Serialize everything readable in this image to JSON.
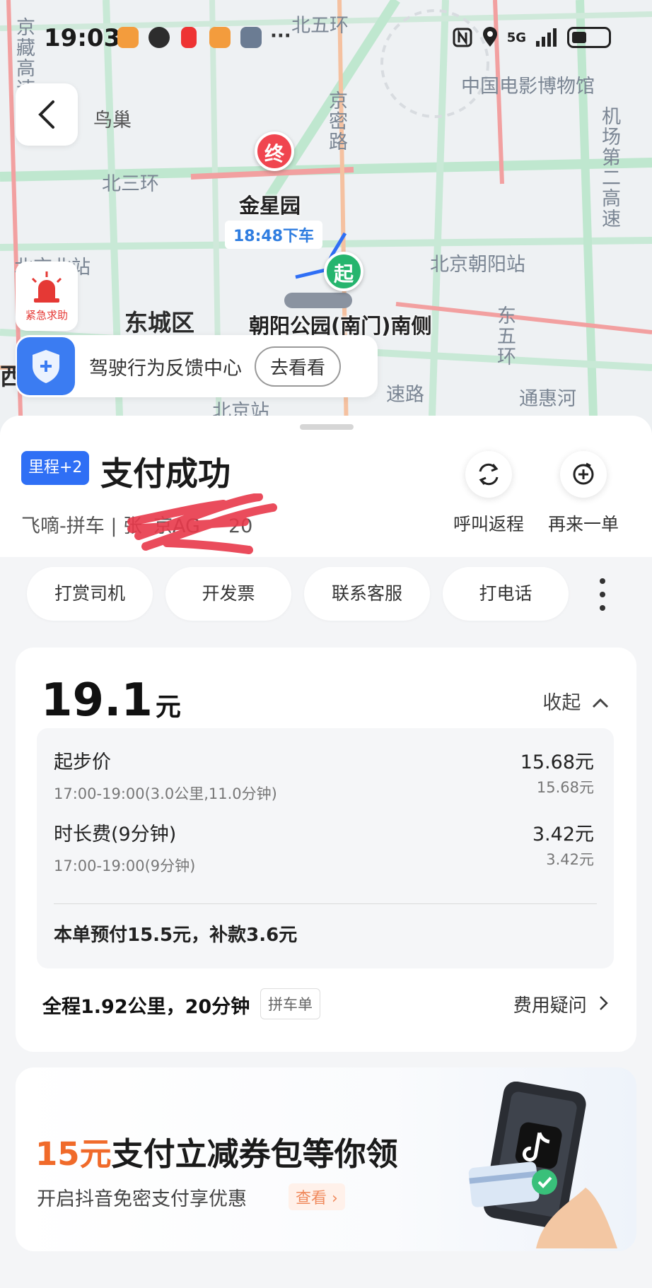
{
  "status": {
    "time": "19:03",
    "network": "5G"
  },
  "map": {
    "labels": {
      "bird_nest": "鸟巢",
      "north_5th_ring": "北五环",
      "film_museum": "中国电影博物馆",
      "jingmi_road": "京密路",
      "north_3rd_ring": "北三环",
      "airport_expressway": "机场第二高速",
      "jingzang_express": "京藏高速",
      "destination": "金星园",
      "eta": "18:48下车",
      "chaoyang_station": "北京朝阳站",
      "beijing_north": "北京北站",
      "dongcheng": "东城区",
      "origin": "朝阳公园(南门)南侧",
      "east_5th_ring": "东五环",
      "tonghui_river": "通惠河",
      "express_road": "速路",
      "beijing_station": "北京站",
      "west": "西"
    },
    "end_pin": "终",
    "start_pin": "起"
  },
  "sos": {
    "label": "紧急求助"
  },
  "feedback": {
    "text": "驾驶行为反馈中心",
    "button": "去看看"
  },
  "order": {
    "badge": "里程+2",
    "title": "支付成功",
    "service_info": "飞嘀-拼车 | 张",
    "plate_partial": "京AG",
    "plate_tail": "20",
    "actions": [
      {
        "label": "呼叫返程",
        "icon": "refresh-icon"
      },
      {
        "label": "再来一单",
        "icon": "add-order-icon"
      }
    ]
  },
  "chips": [
    "打赏司机",
    "开发票",
    "联系客服",
    "打电话"
  ],
  "fare": {
    "total": "19.1",
    "unit": "元",
    "collapse_label": "收起",
    "items": [
      {
        "name": "起步价",
        "sub": "17:00-19:00(3.0公里,11.0分钟)",
        "value": "15.68元",
        "sub_value": "15.68元"
      },
      {
        "name": "时长费(9分钟)",
        "sub": "17:00-19:00(9分钟)",
        "value": "3.42元",
        "sub_value": "3.42元"
      }
    ],
    "prepay_note": "本单预付15.5元，补款3.6元",
    "trip_summary": "全程1.92公里，20分钟",
    "trip_tag": "拼车单",
    "fee_question": "费用疑问"
  },
  "promo": {
    "amount": "15元",
    "headline_rest": "支付立减券包等你领",
    "subtitle": "开启抖音免密支付享优惠",
    "link": "查看"
  },
  "colors": {
    "accent_blue": "#2f6ff5",
    "promo_orange": "#f06a2a",
    "end_red": "#f0454f",
    "start_green": "#26b56e"
  }
}
